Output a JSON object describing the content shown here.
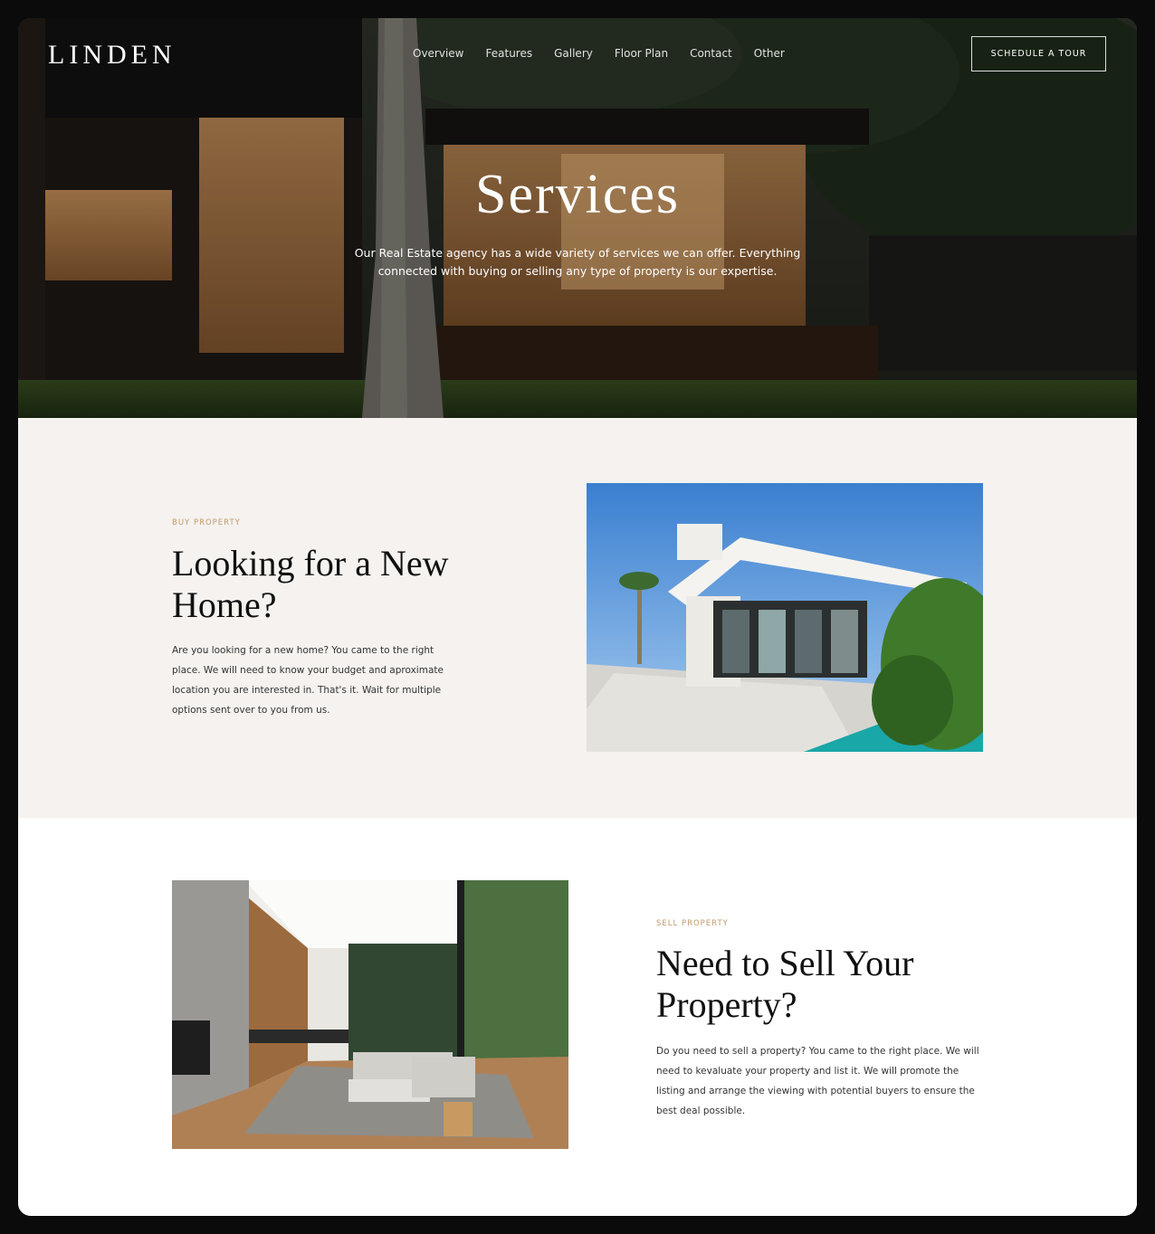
{
  "brand": {
    "logo": "LINDEN"
  },
  "nav": {
    "items": [
      "Overview",
      "Features",
      "Gallery",
      "Floor Plan",
      "Contact",
      "Other"
    ],
    "cta": "SCHEDULE A TOUR"
  },
  "hero": {
    "title": "Services",
    "subtitle": "Our Real Estate agency has a wide variety of services we can offer. Everything connected with buying or selling any type of property is our expertise."
  },
  "buy": {
    "eyebrow": "BUY PROPERTY",
    "heading": "Looking for a New Home?",
    "body": "Are you looking for a new home? You came to the right place. We will need to know your budget and aproximate location you are interested in. That's it. Wait for multiple options sent over to you from us."
  },
  "sell": {
    "eyebrow": "SELL PROPERTY",
    "heading": "Need to Sell Your Property?",
    "body": "Do you need to sell a property? You came to the right place. We will need to kevaluate your property and list it. We will promote the listing and arrange the viewing with potential buyers to ensure the best deal possible."
  },
  "colors": {
    "accent": "#c19a6b",
    "section_bg": "#f5f2ef",
    "frame": "#0b0b0b"
  }
}
